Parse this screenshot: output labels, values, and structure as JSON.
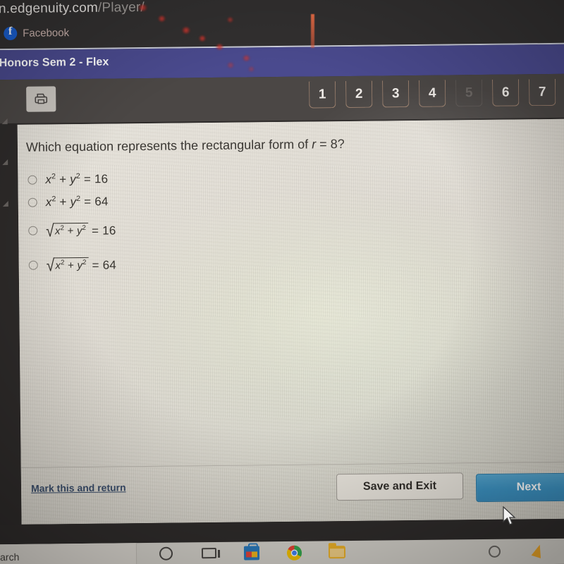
{
  "browser": {
    "url_main": "n.edgenuity.com",
    "url_path": "/Player/",
    "bookmark_tick": "|",
    "bookmark_label": "Facebook"
  },
  "course_bar": {
    "title": "Honors Sem 2 - Flex"
  },
  "toolbar": {
    "print_icon": "printer-icon",
    "question_tabs": [
      {
        "label": "1",
        "state": "available"
      },
      {
        "label": "2",
        "state": "available"
      },
      {
        "label": "3",
        "state": "available"
      },
      {
        "label": "4",
        "state": "available"
      },
      {
        "label": "5",
        "state": "disabled"
      },
      {
        "label": "6",
        "state": "available"
      },
      {
        "label": "7",
        "state": "available"
      }
    ]
  },
  "question": {
    "text_before": "Which equation represents the rectangular form of ",
    "variable": "r",
    "text_after": " = 8?"
  },
  "options": [
    {
      "id": "a",
      "type": "plain",
      "left": "x² + y²",
      "equals": "= 16",
      "selected": false
    },
    {
      "id": "b",
      "type": "plain",
      "left": "x² + y²",
      "equals": "= 64",
      "selected": false
    },
    {
      "id": "c",
      "type": "radical",
      "left": "x² + y²",
      "equals": "= 16",
      "selected": false
    },
    {
      "id": "d",
      "type": "radical",
      "left": "x² + y²",
      "equals": "= 64",
      "selected": false
    }
  ],
  "footer": {
    "mark_link": "Mark this and return",
    "save_label": "Save and Exit",
    "next_label": "Next"
  },
  "taskbar": {
    "search_text": "arch",
    "icons": [
      "cortana-icon",
      "task-view-icon",
      "microsoft-store-icon",
      "google-chrome-icon",
      "file-explorer-icon"
    ]
  },
  "colors": {
    "course_bar": "#4a4a8e",
    "toolbar": "#4b4745",
    "next_button": "#3d94c4",
    "link": "#3b4e6b",
    "panel": "#e2ded6"
  }
}
